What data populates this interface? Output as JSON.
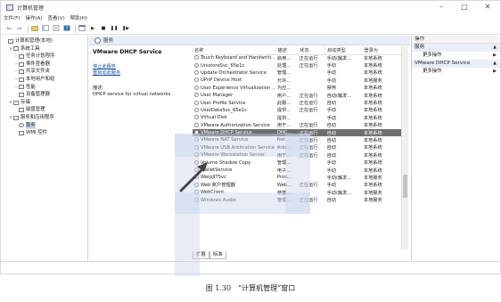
{
  "window": {
    "title": "计算机管理",
    "controls": {
      "minimize": "–",
      "maximize": "□",
      "close": "✕"
    }
  },
  "menu": [
    "文件(F)",
    "操作(A)",
    "查看(V)",
    "帮助(H)"
  ],
  "toolbar": {
    "icons": [
      "back-arrow-icon",
      "forward-arrow-icon",
      "up-folder-icon",
      "show-hide-tree-icon",
      "properties-icon",
      "help-icon",
      "console-icon",
      "play-icon",
      "stop-icon",
      "pause-icon",
      "restart-icon"
    ],
    "glyphs": {
      "back": "⇦",
      "forward": "⇨",
      "play": "▶",
      "stop": "■",
      "pause": "❚❚",
      "restart": "❚▶"
    }
  },
  "tree": [
    {
      "label": "计算机管理(本地)",
      "chev": "",
      "indent": 0
    },
    {
      "label": "系统工具",
      "chev": "∨",
      "indent": 1
    },
    {
      "label": "任务计划程序",
      "chev": "›",
      "indent": 2
    },
    {
      "label": "事件查看器",
      "chev": "›",
      "indent": 2
    },
    {
      "label": "共享文件夹",
      "chev": "›",
      "indent": 2
    },
    {
      "label": "本地用户和组",
      "chev": "›",
      "indent": 2
    },
    {
      "label": "性能",
      "chev": "›",
      "indent": 2
    },
    {
      "label": "设备管理器",
      "chev": "",
      "indent": 2
    },
    {
      "label": "存储",
      "chev": "∨",
      "indent": 1
    },
    {
      "label": "磁盘管理",
      "chev": "",
      "indent": 2
    },
    {
      "label": "服务和应用程序",
      "chev": "∨",
      "indent": 1
    },
    {
      "label": "服务",
      "chev": "",
      "indent": 2,
      "selected": true
    },
    {
      "label": "WMI 控件",
      "chev": "",
      "indent": 2
    }
  ],
  "services_header": {
    "text": "服务"
  },
  "detail": {
    "title": "VMware DHCP Service",
    "links": [
      "停止此服务",
      "重启动此服务"
    ],
    "desc_label": "描述:",
    "desc_text": "DHCP service for virtual networks."
  },
  "table": {
    "columns": [
      "名称",
      "描述",
      "状态",
      "启动类型",
      "登录为"
    ],
    "sort_indicator": "^",
    "rows": [
      [
        "Touch Keyboard and Handwriti...",
        "启用...",
        "正在运行",
        "手动(触发...",
        "本地系统"
      ],
      [
        "UnistoreSvc_65e1c",
        "处理...",
        "正在运行",
        "手动",
        "本地系统"
      ],
      [
        "Update Orchestrator Service",
        "管理...",
        "",
        "手动",
        "本地系统"
      ],
      [
        "UPnP Device Host",
        "允许...",
        "",
        "手动",
        "本地服务"
      ],
      [
        "User Experience Virtualization ...",
        "为应...",
        "",
        "禁用",
        "本地系统"
      ],
      [
        "User Manager",
        "用户...",
        "正在运行",
        "自动(触发...",
        "本地系统"
      ],
      [
        "User Profile Service",
        "此服...",
        "正在运行",
        "自动",
        "本地系统"
      ],
      [
        "UserDataSvc_65e1c",
        "提供...",
        "正在运行",
        "手动",
        "本地系统"
      ],
      [
        "Virtual Disk",
        "提供...",
        "",
        "手动",
        "本地系统"
      ],
      [
        "VMware Authorization Service",
        "用于...",
        "正在运行",
        "自动",
        "本地系统"
      ],
      [
        "VMware DHCP Service",
        "DHC...",
        "正在运行",
        "自动",
        "本地系统"
      ],
      [
        "VMware NAT Service",
        "Net...",
        "正在运行",
        "自动",
        "本地系统"
      ],
      [
        "VMware USB Arbitration Service",
        "Arbi...",
        "正在运行",
        "自动",
        "本地系统"
      ],
      [
        "VMware Workstation Server",
        "用于...",
        "正在运行",
        "自动",
        "本地系统"
      ],
      [
        "Volume Shadow Copy",
        "管理...",
        "",
        "手动",
        "本地系统"
      ],
      [
        "WalletService",
        "电子...",
        "",
        "手动",
        "本地系统"
      ],
      [
        "WarpJITSvc",
        "Prov...",
        "",
        "手动(触发...",
        "本地服务"
      ],
      [
        "Web 账户管理器",
        "Web...",
        "正在运行",
        "手动",
        "本地系统"
      ],
      [
        "WebClient",
        "使基...",
        "",
        "手动(触发...",
        "本地服务"
      ],
      [
        "Windows Audio",
        "管理...",
        "正在运行",
        "自动",
        "本地服务"
      ]
    ],
    "selected_index": 10
  },
  "tabs": [
    "扩展",
    "标准"
  ],
  "actions": {
    "header": "操作",
    "groups": [
      {
        "label": "服务",
        "triangle": "▲",
        "items": [
          {
            "label": "更多操作",
            "triangle": "▶"
          }
        ]
      },
      {
        "label": "VMware DHCP Service",
        "triangle": "▲",
        "items": [
          {
            "label": "更多操作",
            "triangle": "▶"
          }
        ]
      }
    ]
  },
  "caption": "图 1.30　“计算机管理”窗口",
  "colors": {
    "selected_row": "#6e6e6e",
    "header_bar": "#e7eef8",
    "link": "#1a4fa0"
  }
}
